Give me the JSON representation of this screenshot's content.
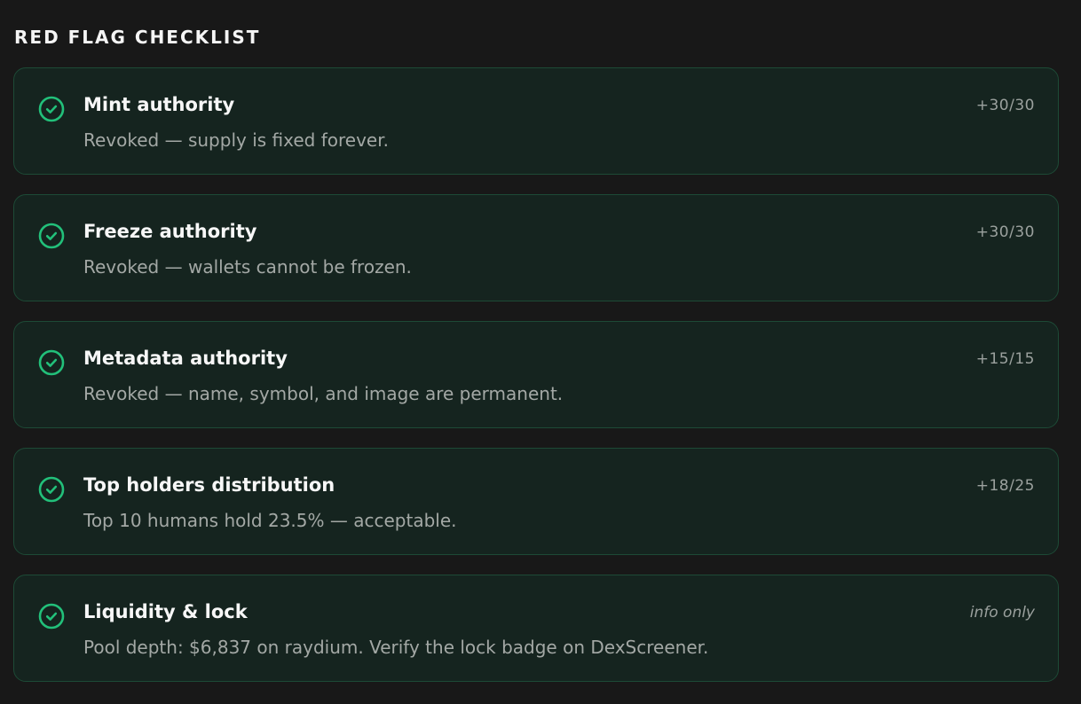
{
  "section": {
    "title": "RED FLAG CHECKLIST"
  },
  "colors": {
    "accent": "#22c07a",
    "card_bg": "#15241f",
    "card_border": "#1d4a36",
    "page_bg": "#181818"
  },
  "items": [
    {
      "icon": "check-circle-icon",
      "title": "Mint authority",
      "description": "Revoked — supply is fixed forever.",
      "score": "+30/30"
    },
    {
      "icon": "check-circle-icon",
      "title": "Freeze authority",
      "description": "Revoked — wallets cannot be frozen.",
      "score": "+30/30"
    },
    {
      "icon": "check-circle-icon",
      "title": "Metadata authority",
      "description": "Revoked — name, symbol, and image are permanent.",
      "score": "+15/15"
    },
    {
      "icon": "check-circle-icon",
      "title": "Top holders distribution",
      "description": "Top 10 humans hold 23.5% — acceptable.",
      "score": "+18/25"
    },
    {
      "icon": "check-circle-icon",
      "title": "Liquidity & lock",
      "description": "Pool depth: $6,837 on raydium. Verify the lock badge on DexScreener.",
      "score": "info only"
    }
  ]
}
